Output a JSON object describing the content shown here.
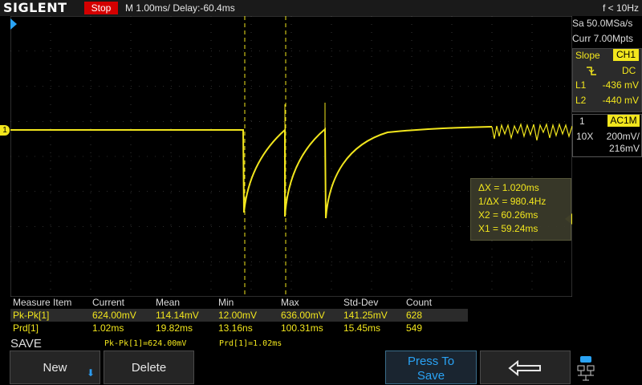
{
  "header": {
    "brand": "SIGLENT",
    "run_state": "Stop",
    "timebase": "M 1.00ms/ Delay:-60.4ms",
    "frequency": "f < 10Hz"
  },
  "acquisition": {
    "sample_rate": "Sa 50.0MSa/s",
    "memory_depth": "Curr 7.00Mpts"
  },
  "trigger": {
    "slope_label": "Slope",
    "source": "CH1",
    "coupling": "DC",
    "l1_label": "L1",
    "l1_value": "-436 mV",
    "l2_label": "L2",
    "l2_value": "-440 mV"
  },
  "channel": {
    "number": "1",
    "coupling": "AC1M",
    "probe": "10X",
    "volts_per_div": "200mV/",
    "offset": "216mV",
    "marker": "1",
    "color": "#f2e61d"
  },
  "cursors": {
    "delta_x": "ΔX = 1.020ms",
    "inv_delta_x": "1/ΔX = 980.4Hz",
    "x2": "X2 = 60.26ms",
    "x1": "X1 = 59.24ms"
  },
  "measurements": {
    "headers": [
      "Measure Item",
      "Current",
      "Mean",
      "Min",
      "Max",
      "Std-Dev",
      "Count"
    ],
    "rows": [
      [
        "Pk-Pk[1]",
        "624.00mV",
        "114.14mV",
        "12.00mV",
        "636.00mV",
        "141.25mV",
        "628"
      ],
      [
        "Prd[1]",
        "1.02ms",
        "19.82ms",
        "13.16ns",
        "100.31ms",
        "15.45ms",
        "549"
      ]
    ]
  },
  "status": {
    "menu_title": "SAVE",
    "readout1": "Pk-Pk[1]=624.00mV",
    "readout2": "Prd[1]=1.02ms"
  },
  "softkeys": {
    "new": "New",
    "delete": "Delete",
    "press_to_save_line1": "Press To",
    "press_to_save_line2": "Save",
    "back_icon": "return-arrow-icon"
  },
  "colors": {
    "trace": "#f2e61d",
    "stop": "#d40000",
    "accent_blue": "#2aa3f5",
    "grid": "#5a5a5a"
  }
}
